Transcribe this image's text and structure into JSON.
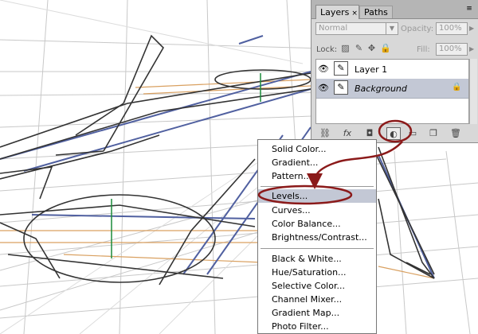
{
  "layers_panel": {
    "tabs": [
      {
        "label": "Layers",
        "close": "×"
      },
      {
        "label": "Paths"
      }
    ],
    "menu_icon": "≡",
    "blend_mode": "Normal",
    "opacity_label": "Opacity:",
    "opacity_value": "100%",
    "lock_label": "Lock:",
    "fill_label": "Fill:",
    "fill_value": "100%",
    "layers": [
      {
        "name": "Layer 1"
      },
      {
        "name": "Background",
        "locked": true
      }
    ],
    "bottom_icons": [
      "link-icon",
      "fx-icon",
      "mask-icon",
      "adjustment-layer-icon",
      "folder-icon",
      "new-layer-icon",
      "trash-icon"
    ]
  },
  "adjustment_menu": {
    "groups": [
      [
        "Solid Color...",
        "Gradient...",
        "Pattern..."
      ],
      [
        "Levels...",
        "Curves...",
        "Color Balance...",
        "Brightness/Contrast..."
      ],
      [
        "Black & White...",
        "Hue/Saturation...",
        "Selective Color...",
        "Channel Mixer...",
        "Gradient Map...",
        "Photo Filter..."
      ]
    ],
    "highlighted": "Levels..."
  },
  "colors": {
    "annotation": "#8b1a1a",
    "highlight": "#c3c8d5",
    "panel": "#d8d8d8"
  }
}
